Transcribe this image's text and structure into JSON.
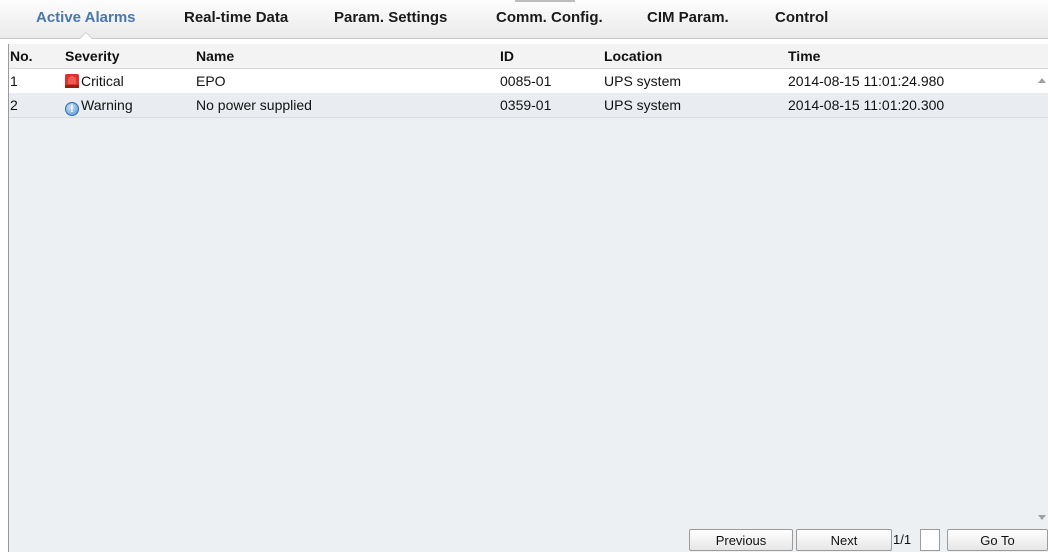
{
  "tabs": [
    {
      "label": "Active Alarms",
      "active": true
    },
    {
      "label": "Real-time Data",
      "active": false
    },
    {
      "label": "Param. Settings",
      "active": false
    },
    {
      "label": "Comm. Config.",
      "active": false
    },
    {
      "label": "CIM Param.",
      "active": false
    },
    {
      "label": "Control",
      "active": false
    }
  ],
  "table": {
    "columns": [
      "No.",
      "Severity",
      "Name",
      "ID",
      "Location",
      "Time"
    ],
    "rows": [
      {
        "no": "1",
        "severity": "Critical",
        "severity_icon": "critical-alarm-icon",
        "name": "EPO",
        "id": "0085-01",
        "location": "UPS system",
        "time": "2014-08-15 11:01:24.980"
      },
      {
        "no": "2",
        "severity": "Warning",
        "severity_icon": "warning-alarm-icon",
        "name": "No power supplied",
        "id": "0359-01",
        "location": "UPS system",
        "time": "2014-08-15 11:01:20.300"
      }
    ]
  },
  "pager": {
    "previous_label": "Previous",
    "next_label": "Next",
    "page_count": "1/1",
    "page_input_value": "",
    "goto_label": "Go To"
  },
  "colors": {
    "active_tab": "#4a78ad",
    "critical": "#d9342b",
    "warning": "#4d8fd1",
    "table_background": "#edf0f3"
  }
}
